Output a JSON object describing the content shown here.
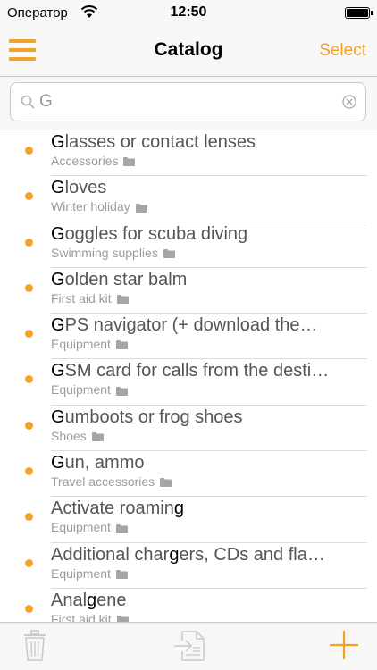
{
  "status_bar": {
    "carrier": "Оператор",
    "time": "12:50"
  },
  "nav": {
    "title": "Catalog",
    "select_label": "Select"
  },
  "search": {
    "value": "G",
    "placeholder": ""
  },
  "items": [
    {
      "pre": "",
      "hl": "G",
      "post": "lasses or contact lenses",
      "category": "Accessories"
    },
    {
      "pre": "",
      "hl": "G",
      "post": "loves",
      "category": "Winter holiday"
    },
    {
      "pre": "",
      "hl": "G",
      "post": "oggles for scuba diving",
      "category": "Swimming supplies"
    },
    {
      "pre": "",
      "hl": "G",
      "post": "olden star balm",
      "category": "First aid kit"
    },
    {
      "pre": "",
      "hl": "G",
      "post": "PS navigator (+ download the…",
      "category": "Equipment"
    },
    {
      "pre": "",
      "hl": "G",
      "post": "SM card for calls from the desti…",
      "category": "Equipment"
    },
    {
      "pre": "",
      "hl": "G",
      "post": "umboots or frog shoes",
      "category": "Shoes"
    },
    {
      "pre": "",
      "hl": "G",
      "post": "un, ammo",
      "category": "Travel accessories"
    },
    {
      "pre": "Activate roamin",
      "hl": "g",
      "post": "",
      "category": "Equipment"
    },
    {
      "pre": "Additional char",
      "hl": "g",
      "post": "ers, CDs and fla…",
      "category": "Equipment"
    },
    {
      "pre": "Anal",
      "hl": "g",
      "post": "ene",
      "category": "First aid kit"
    }
  ],
  "colors": {
    "accent": "#f4a12a",
    "bar_background": "#f7f7f7",
    "subtitle": "#9b9b9b"
  },
  "icons": {
    "menu": "hamburger-icon",
    "search": "search-icon",
    "clear": "clear-icon",
    "folder": "folder-icon",
    "trash": "trash-icon",
    "import": "import-icon",
    "add": "plus-icon"
  }
}
